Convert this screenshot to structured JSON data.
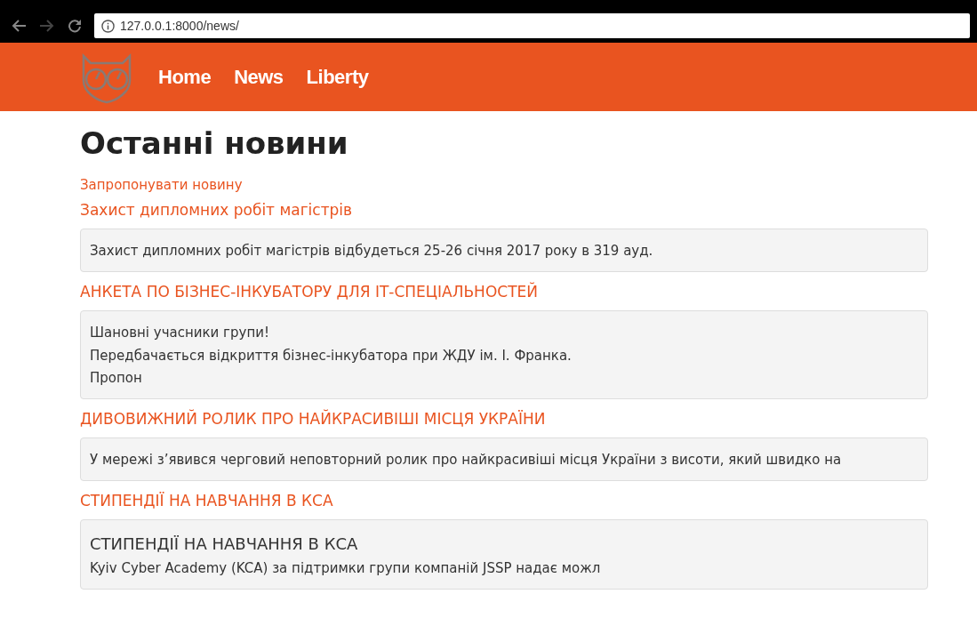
{
  "browser": {
    "url": "127.0.0.1:8000/news/"
  },
  "navbar": {
    "links": [
      {
        "label": "Home"
      },
      {
        "label": "News"
      },
      {
        "label": "Liberty"
      }
    ]
  },
  "page_title": "Останні новини",
  "suggest_link": "Запропонувати новину",
  "posts": [
    {
      "title": "Захист дипломних робіт магістрів",
      "paragraphs": [
        "Захист дипломних робіт магістрів відбудеться 25-26 січня 2017 року в 319 ауд."
      ]
    },
    {
      "title": "АНКЕТА ПО БІЗНЕС-ІНКУБАТОРУ ДЛЯ ІТ-СПЕЦІАЛЬНОСТЕЙ",
      "paragraphs": [
        "Шановні учасники групи!",
        "Передбачається відкриття бізнес-інкубатора при ЖДУ ім. І. Франка.",
        "Пропон"
      ]
    },
    {
      "title": "ДИВОВИЖНИЙ РОЛИК ПРО НАЙКРАСИВІШІ МІСЦЯ УКРАЇНИ",
      "paragraphs": [
        "У мережі з’явився черговий неповторний ролик про найкрасивіші місця України з висоти, який швидко на"
      ]
    },
    {
      "title": "СТИПЕНДІЇ НА НАВЧАННЯ В КСА",
      "heading": "СТИПЕНДІЇ НА НАВЧАННЯ В КСА",
      "paragraphs": [
        "Kyiv Cyber Academy (KCA) за підтримки групи компаній JSSP надає можл"
      ]
    }
  ]
}
